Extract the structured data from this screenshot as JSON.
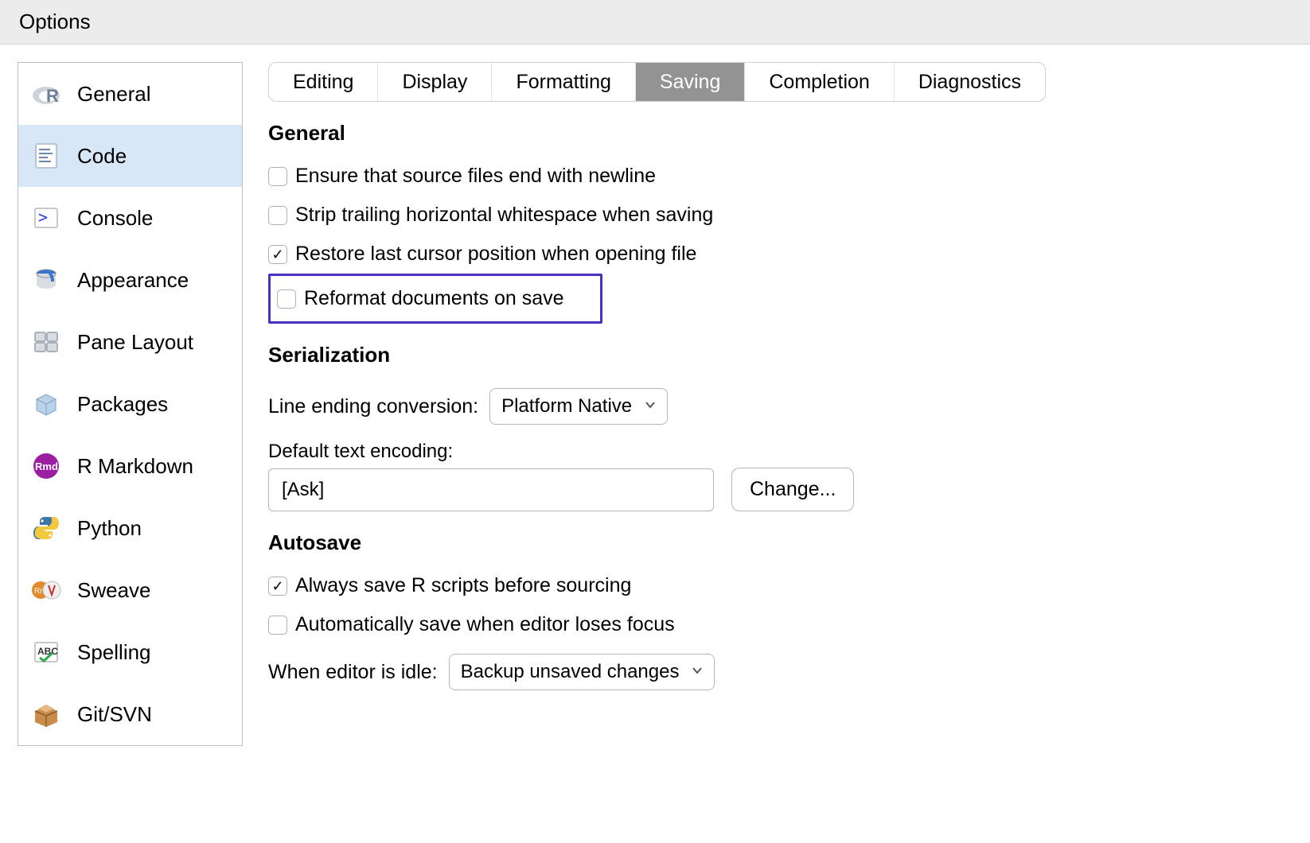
{
  "window": {
    "title": "Options"
  },
  "sidebar": {
    "items": [
      {
        "id": "general",
        "label": "General",
        "selected": false
      },
      {
        "id": "code",
        "label": "Code",
        "selected": true
      },
      {
        "id": "console",
        "label": "Console",
        "selected": false
      },
      {
        "id": "appearance",
        "label": "Appearance",
        "selected": false
      },
      {
        "id": "pane-layout",
        "label": "Pane Layout",
        "selected": false
      },
      {
        "id": "packages",
        "label": "Packages",
        "selected": false
      },
      {
        "id": "r-markdown",
        "label": "R Markdown",
        "selected": false
      },
      {
        "id": "python",
        "label": "Python",
        "selected": false
      },
      {
        "id": "sweave",
        "label": "Sweave",
        "selected": false
      },
      {
        "id": "spelling",
        "label": "Spelling",
        "selected": false
      },
      {
        "id": "git-svn",
        "label": "Git/SVN",
        "selected": false
      }
    ]
  },
  "tabs": [
    {
      "id": "editing",
      "label": "Editing",
      "active": false
    },
    {
      "id": "display",
      "label": "Display",
      "active": false
    },
    {
      "id": "formatting",
      "label": "Formatting",
      "active": false
    },
    {
      "id": "saving",
      "label": "Saving",
      "active": true
    },
    {
      "id": "completion",
      "label": "Completion",
      "active": false
    },
    {
      "id": "diagnostics",
      "label": "Diagnostics",
      "active": false
    }
  ],
  "sections": {
    "general": {
      "title": "General",
      "options": [
        {
          "id": "end-newline",
          "label": "Ensure that source files end with newline",
          "checked": false,
          "highlight": false
        },
        {
          "id": "strip-whitespace",
          "label": "Strip trailing horizontal whitespace when saving",
          "checked": false,
          "highlight": false
        },
        {
          "id": "restore-cursor",
          "label": "Restore last cursor position when opening file",
          "checked": true,
          "highlight": false
        },
        {
          "id": "reformat-on-save",
          "label": "Reformat documents on save",
          "checked": false,
          "highlight": true
        }
      ]
    },
    "serialization": {
      "title": "Serialization",
      "line_ending_label": "Line ending conversion:",
      "line_ending_value": "Platform Native",
      "encoding_label": "Default text encoding:",
      "encoding_value": "[Ask]",
      "change_button": "Change..."
    },
    "autosave": {
      "title": "Autosave",
      "options": [
        {
          "id": "save-before-source",
          "label": "Always save R scripts before sourcing",
          "checked": true
        },
        {
          "id": "save-on-blur",
          "label": "Automatically save when editor loses focus",
          "checked": false
        }
      ],
      "idle_label": "When editor is idle:",
      "idle_value": "Backup unsaved changes"
    }
  }
}
